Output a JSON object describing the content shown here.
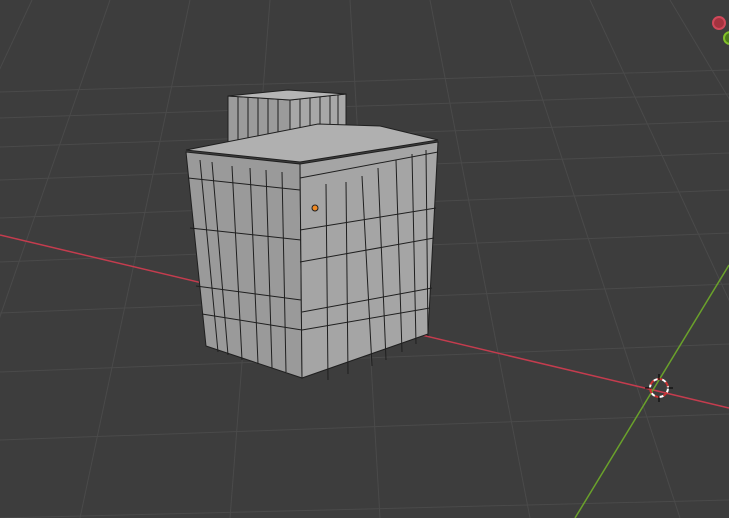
{
  "viewport": {
    "background": "#3d3d3d",
    "grid_color": "#4a4a4a",
    "x_axis_color": "#c43c4e",
    "y_axis_color": "#6aa12b"
  },
  "object": {
    "name_icon": "building-mesh",
    "face_color": "#a6a6a6",
    "edge_color": "#1f1f1f",
    "origin_color": "#f08a24"
  },
  "gizmo": {
    "x_axis_icon": "x-axis-gizmo-icon",
    "y_axis_icon": "y-axis-gizmo-icon"
  },
  "cursor": {
    "icon": "3d-cursor-icon",
    "ring_colors": [
      "#cc3333",
      "#ffffff"
    ]
  }
}
